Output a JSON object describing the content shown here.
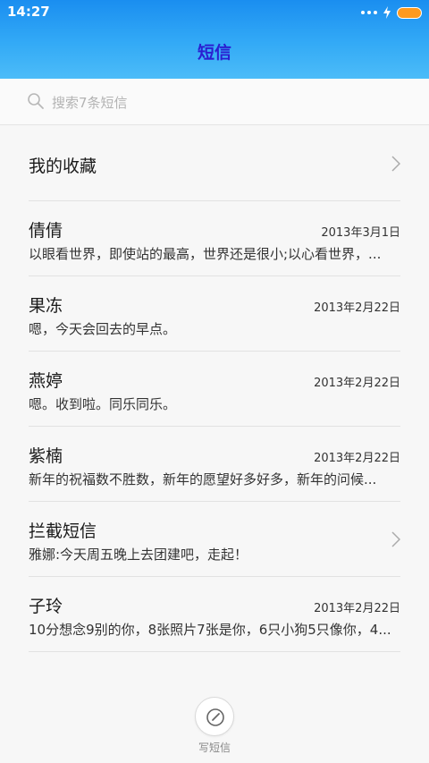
{
  "status_bar": {
    "time": "14:27",
    "battery_color": "#ff9a1f"
  },
  "header": {
    "title": "短信",
    "title_color": "#2a1fd1"
  },
  "search": {
    "placeholder": "搜索7条短信",
    "icon": "search-icon"
  },
  "favorites": {
    "label": "我的收藏",
    "icon": "chevron-right-icon"
  },
  "messages": [
    {
      "name": "倩倩",
      "date": "2013年3月1日",
      "preview": "以眼看世界，即使站的最高，世界还是很小;以心看世界，..."
    },
    {
      "name": "果冻",
      "date": "2013年2月22日",
      "preview": "嗯，今天会回去的早点。"
    },
    {
      "name": "燕婷",
      "date": "2013年2月22日",
      "preview": "嗯。收到啦。同乐同乐。"
    },
    {
      "name": "紫楠",
      "date": "2013年2月22日",
      "preview": "新年的祝福数不胜数，新年的愿望好多好多，新年的问候..."
    },
    {
      "name": "拦截短信",
      "date": "",
      "preview": "雅娜:今天周五晚上去团建吧，走起！",
      "icon": "chevron-right-icon"
    },
    {
      "name": "子玲",
      "date": "2013年2月22日",
      "preview": "10分想念9别的你，8张照片7张是你，6只小狗5只像你，4..."
    }
  ],
  "compose": {
    "label": "写短信",
    "icon": "compose-icon"
  }
}
